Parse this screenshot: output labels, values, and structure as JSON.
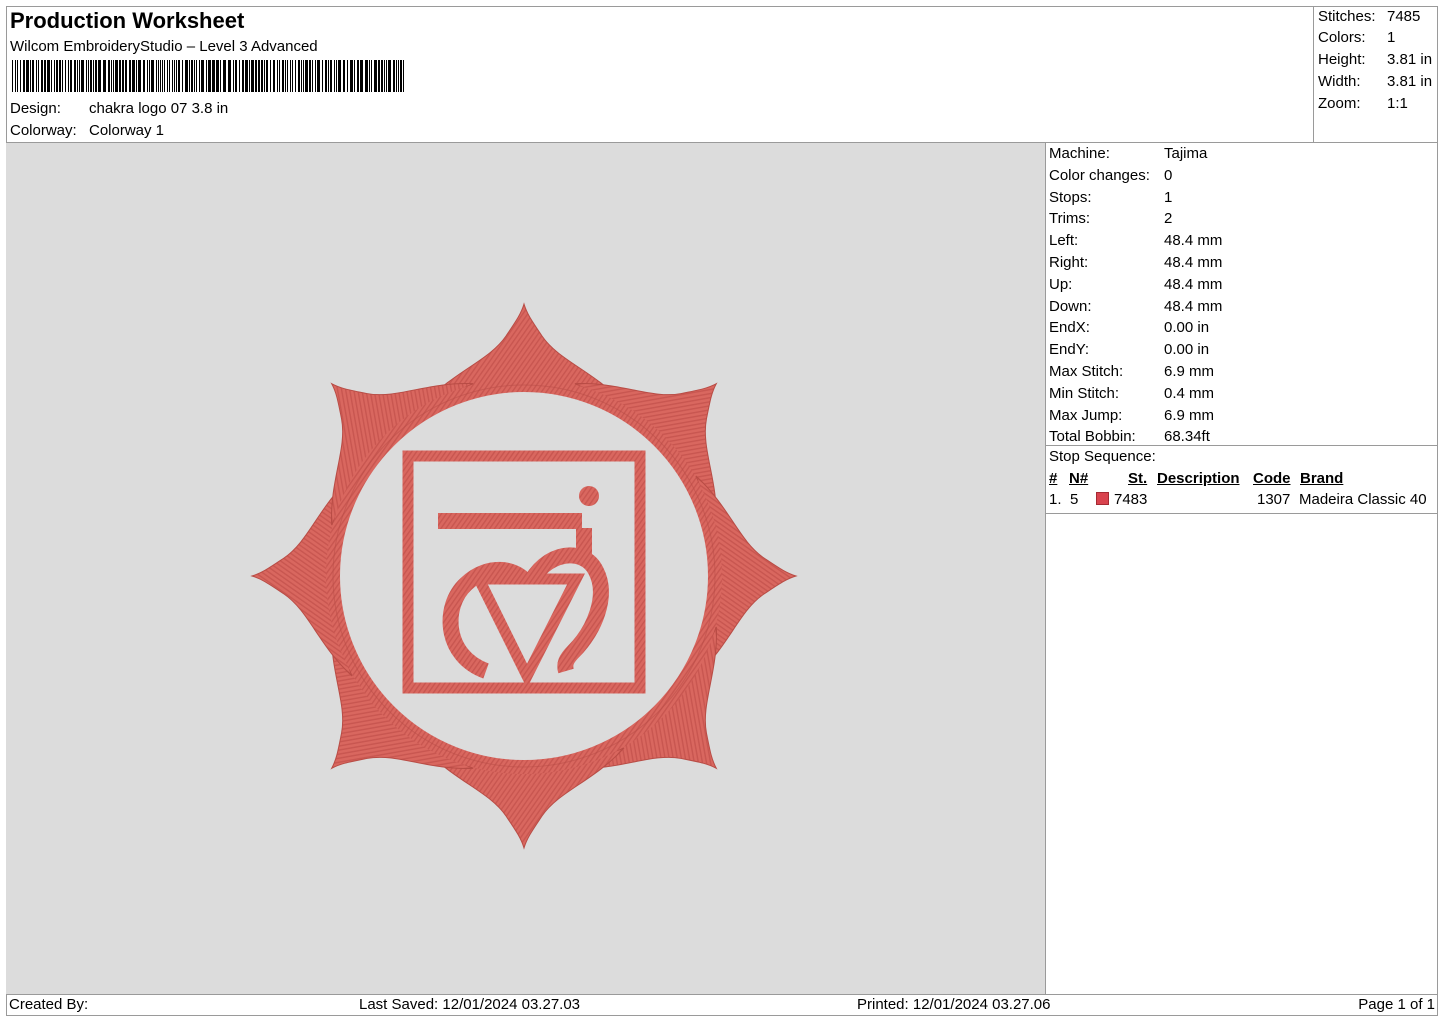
{
  "header": {
    "title": "Production Worksheet",
    "software": "Wilcom EmbroideryStudio – Level 3 Advanced",
    "design_label": "Design:",
    "design_value": "chakra logo 07 3.8 in",
    "colorway_label": "Colorway:",
    "colorway_value": "Colorway 1"
  },
  "stats": [
    {
      "label": "Stitches:",
      "value": "7485"
    },
    {
      "label": "Colors:",
      "value": "1"
    },
    {
      "label": "Height:",
      "value": "3.81 in"
    },
    {
      "label": "Width:",
      "value": "3.81 in"
    },
    {
      "label": "Zoom:",
      "value": "1:1"
    }
  ],
  "machine_info": [
    {
      "label": "Machine:",
      "value": "Tajima"
    },
    {
      "label": "Color changes:",
      "value": "0"
    },
    {
      "label": "Stops:",
      "value": "1"
    },
    {
      "label": "Trims:",
      "value": "2"
    },
    {
      "label": "Left:",
      "value": "48.4 mm"
    },
    {
      "label": "Right:",
      "value": "48.4 mm"
    },
    {
      "label": "Up:",
      "value": "48.4 mm"
    },
    {
      "label": "Down:",
      "value": "48.4 mm"
    },
    {
      "label": "EndX:",
      "value": "0.00 in"
    },
    {
      "label": "EndY:",
      "value": "0.00 in"
    },
    {
      "label": "Max Stitch:",
      "value": "6.9 mm"
    },
    {
      "label": "Min Stitch:",
      "value": "0.4 mm"
    },
    {
      "label": "Max Jump:",
      "value": "6.9 mm"
    },
    {
      "label": "Total Bobbin:",
      "value": "68.34ft"
    }
  ],
  "stop_sequence": {
    "label": "Stop Sequence:",
    "columns": {
      "num": "#",
      "n": "N#",
      "st": "St.",
      "description": "Description",
      "code": "Code",
      "brand": "Brand"
    },
    "rows": [
      {
        "num": "1.",
        "n": "5",
        "st": "7483",
        "description": "",
        "code": "1307",
        "brand": "Madeira Classic 40",
        "color": "#d9434e"
      }
    ]
  },
  "footer": {
    "created_by": "Created By:",
    "last_saved": "Last Saved: 12/01/2024 03.27.03",
    "printed": "Printed: 12/01/2024 03.27.06",
    "page": "Page 1 of 1"
  },
  "design_colors": {
    "thread": "#d9675f",
    "thread_dark": "#b84c45",
    "background": "#dcdcdc"
  }
}
